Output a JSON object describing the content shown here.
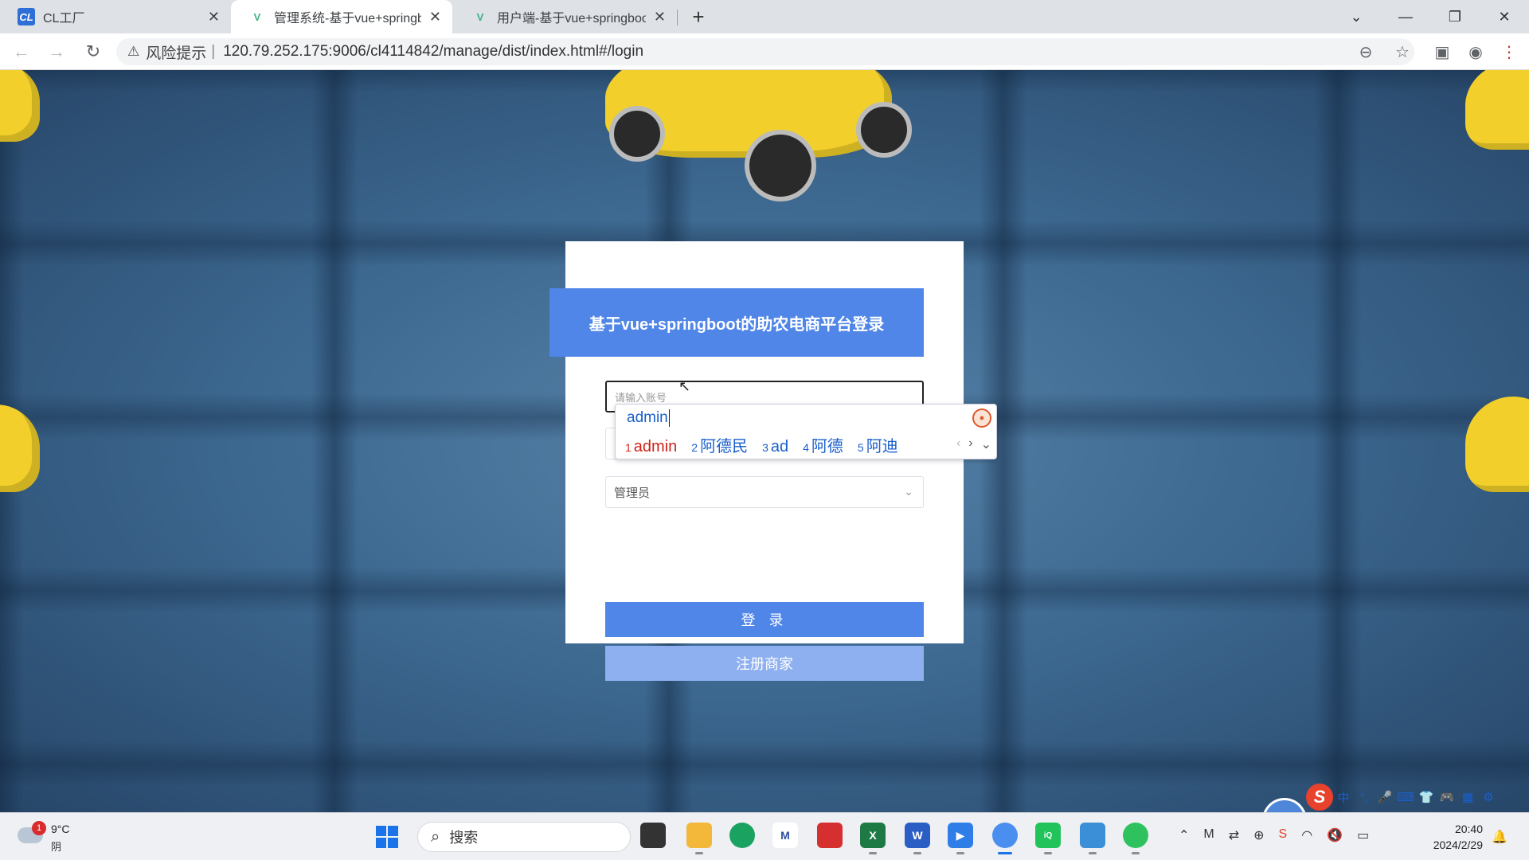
{
  "browser": {
    "tabs": [
      {
        "title": "CL工厂",
        "favicon": "CL",
        "active": false
      },
      {
        "title": "管理系统-基于vue+springbo",
        "favicon": "V",
        "active": true
      },
      {
        "title": "用户端-基于vue+springboot",
        "favicon": "V",
        "active": false
      }
    ],
    "new_tab": "+",
    "address": {
      "risk_label": "风险提示",
      "separator": "|",
      "url": "120.79.252.175:9006/cl4114842/manage/dist/index.html#/login"
    }
  },
  "login": {
    "title": "基于vue+springboot的助农电商平台登录",
    "username_placeholder": "请输入账号",
    "role_selected": "管理员",
    "login_button": "登 录",
    "register_button": "注册商家"
  },
  "ime": {
    "composition": "admin",
    "candidates": [
      {
        "n": "1",
        "text": "admin"
      },
      {
        "n": "2",
        "text": "阿德民"
      },
      {
        "n": "3",
        "text": "ad"
      },
      {
        "n": "4",
        "text": "阿德"
      },
      {
        "n": "5",
        "text": "阿迪"
      }
    ],
    "status_items": [
      "中",
      "°,",
      "🎤",
      "⌨",
      "👕",
      "🎮",
      "▦",
      "⚙"
    ]
  },
  "taskbar": {
    "weather_badge": "1",
    "temperature": "9°C",
    "condition": "阴",
    "search_placeholder": "搜索",
    "time": "20:40",
    "date": "2024/2/29"
  },
  "colors": {
    "accent": "#4f86e8",
    "register": "#8fb0f0",
    "ime_first": "#d0221a",
    "ime_text": "#1a5fcc"
  }
}
